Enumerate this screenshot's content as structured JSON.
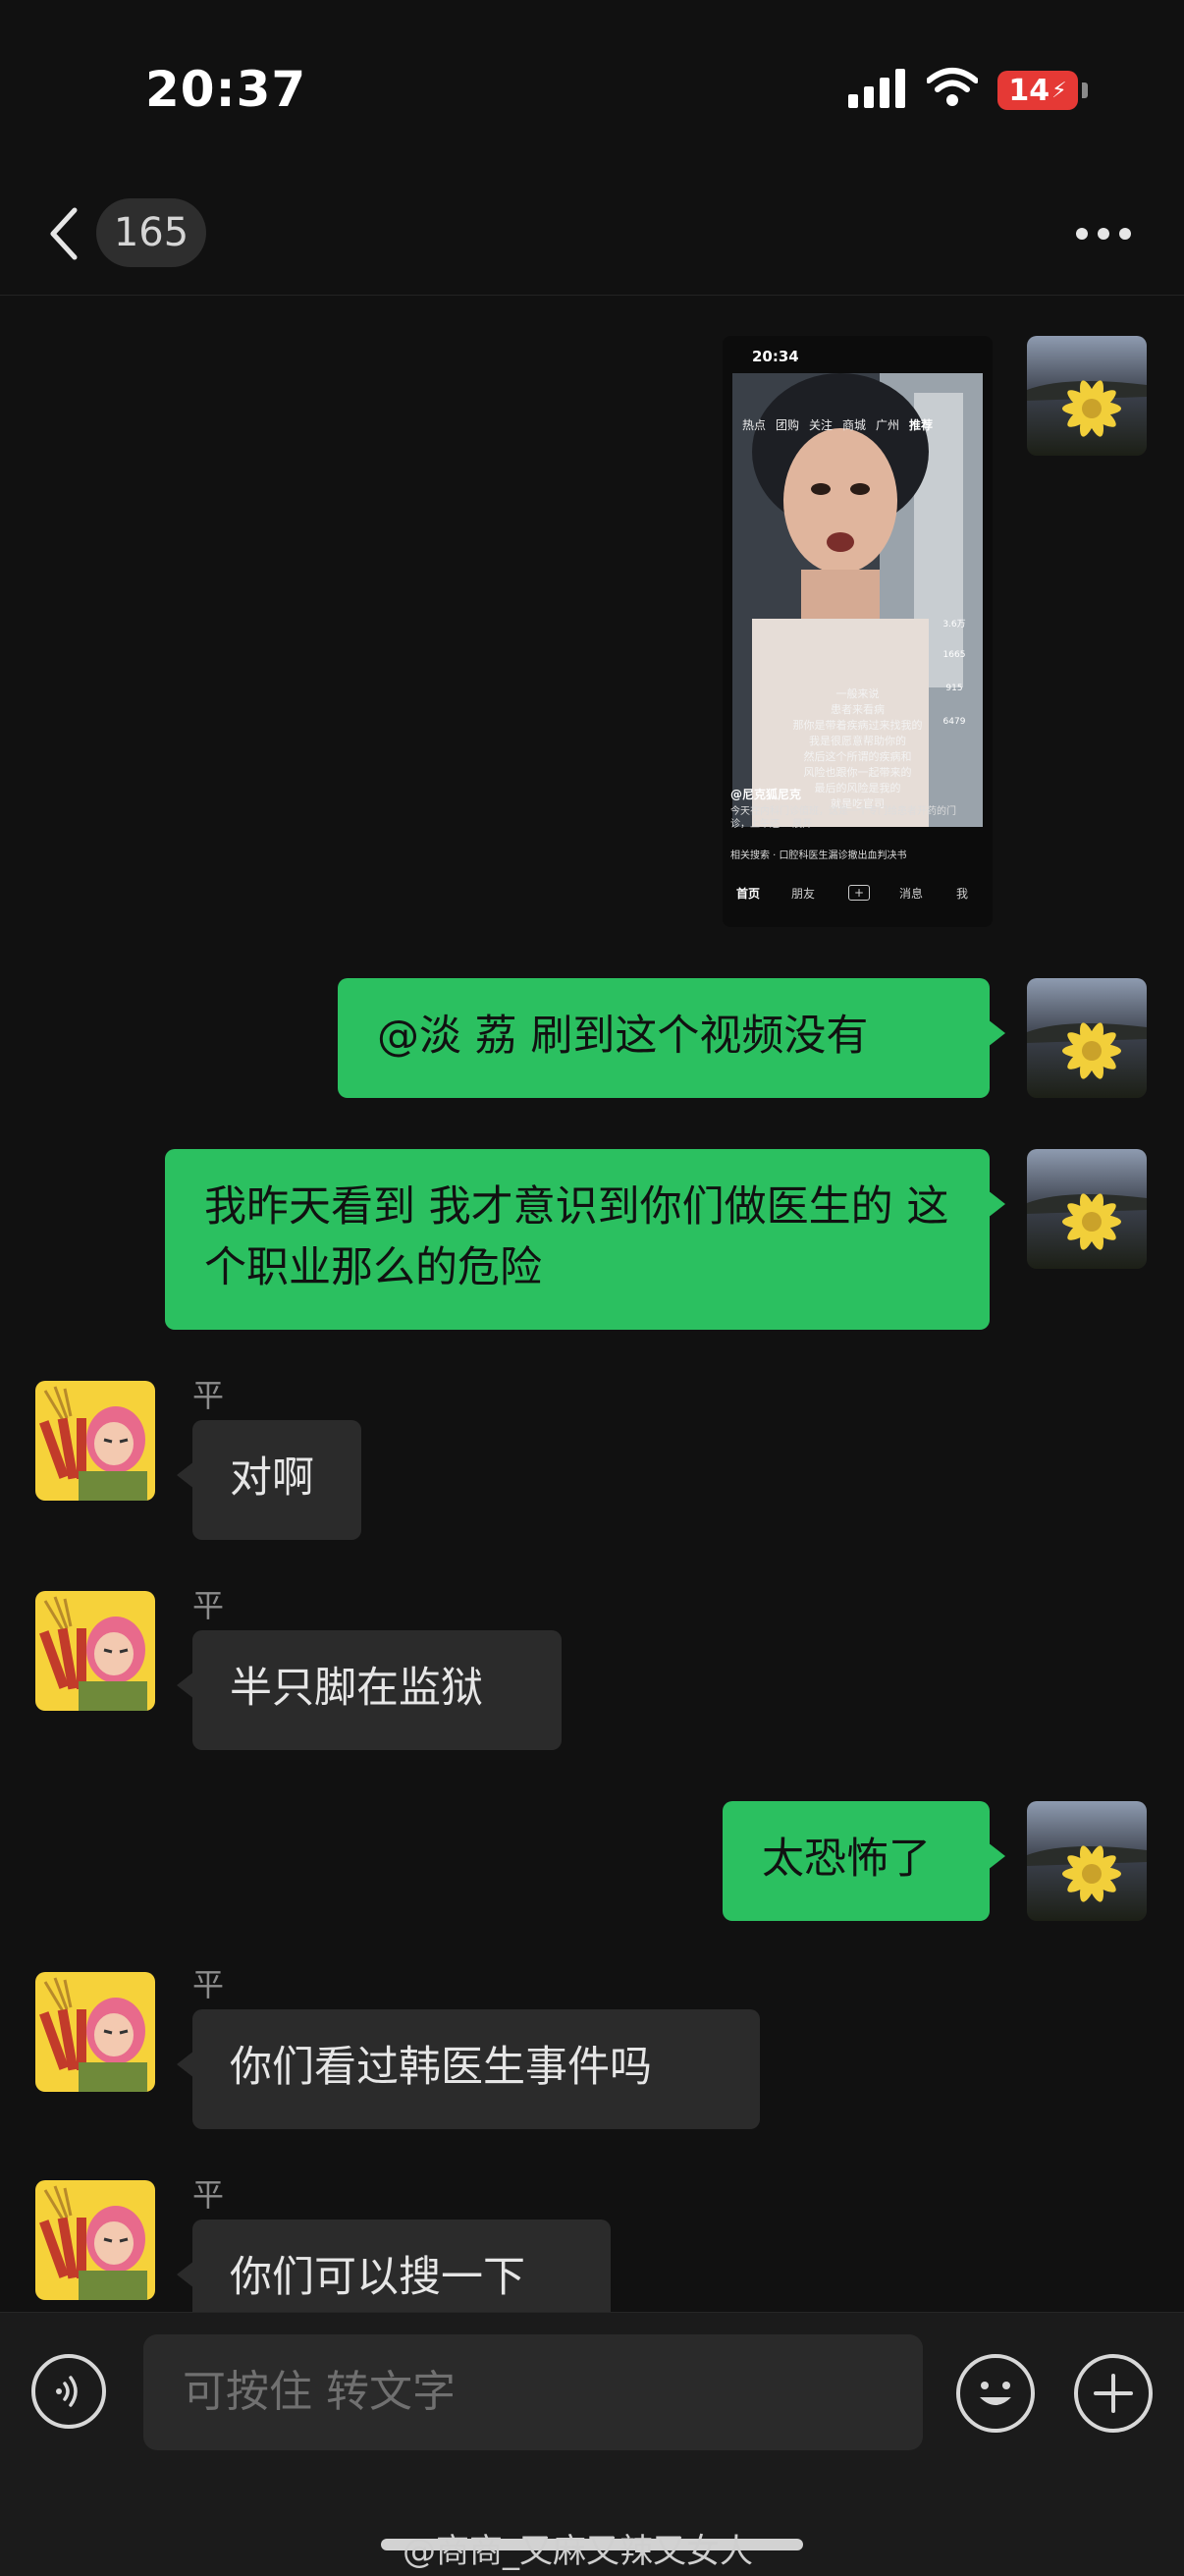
{
  "status": {
    "time": "20:37",
    "battery": "14"
  },
  "nav": {
    "unread_count": "165",
    "title": ""
  },
  "shared_screenshot": {
    "time": "20:34",
    "tabs": [
      "热点",
      "团购",
      "关注",
      "商城",
      "广州",
      "推荐"
    ],
    "captions": [
      "一般来说",
      "患者来看病",
      "那你是带着疾病过来找我的",
      "我是很愿意帮助你的",
      "然后这个所谓的疾病和",
      "风险也跟你一起带来的",
      "最后的风险是我的",
      "就是吃官司"
    ],
    "side_counts": [
      "3.6万",
      "1665",
      "915",
      "6479"
    ],
    "author": "@尼克狐尼克",
    "description": "今天在内科门诊值班，这是一个专门给患者开药的门诊，上午还… 展开",
    "search": "相关搜索 · 口腔科医生漏诊撤出血判决书",
    "bottom_nav": [
      "首页",
      "朋友",
      "+",
      "消息",
      "我"
    ]
  },
  "messages": [
    {
      "side": "right",
      "text": "@淡  荔 刷到这个视频没有"
    },
    {
      "side": "right",
      "text": "我昨天看到 我才意识到你们做医生的  这个职业那么的危险"
    },
    {
      "side": "left",
      "sender": "平",
      "text": "对啊"
    },
    {
      "side": "left",
      "sender": "平",
      "text": "半只脚在监狱"
    },
    {
      "side": "right",
      "text": "太恐怖了"
    },
    {
      "side": "left",
      "sender": "平",
      "text": "你们看过韩医生事件吗"
    },
    {
      "side": "left",
      "sender": "平",
      "text": "你们可以搜一下"
    }
  ],
  "input": {
    "placeholder": "可按住 转文字"
  },
  "watermark": "@商商_又麻又辣又女人",
  "icons": [
    "back-icon",
    "more-icon",
    "voice-icon",
    "emoji-icon",
    "plus-icon",
    "signal-icon",
    "wifi-icon",
    "battery-icon"
  ]
}
